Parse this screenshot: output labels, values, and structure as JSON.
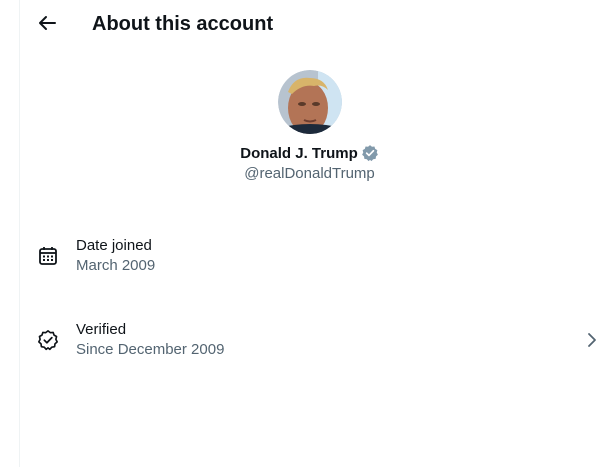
{
  "header": {
    "title": "About this account",
    "back_icon": "back-arrow-icon"
  },
  "profile": {
    "display_name": "Donald J. Trump",
    "handle": "@realDonaldTrump",
    "verified_badge_color": "#829aab",
    "avatar_icon": "avatar"
  },
  "details": [
    {
      "label": "Date joined",
      "value": "March 2009",
      "icon": "calendar-icon"
    },
    {
      "label": "Verified",
      "value": "Since December 2009",
      "icon": "verified-badge-icon",
      "chevron_icon": "chevron-right-icon"
    }
  ],
  "colors": {
    "primary_text": "#0f1419",
    "secondary_text": "#536471",
    "divider": "#eff3f4"
  }
}
